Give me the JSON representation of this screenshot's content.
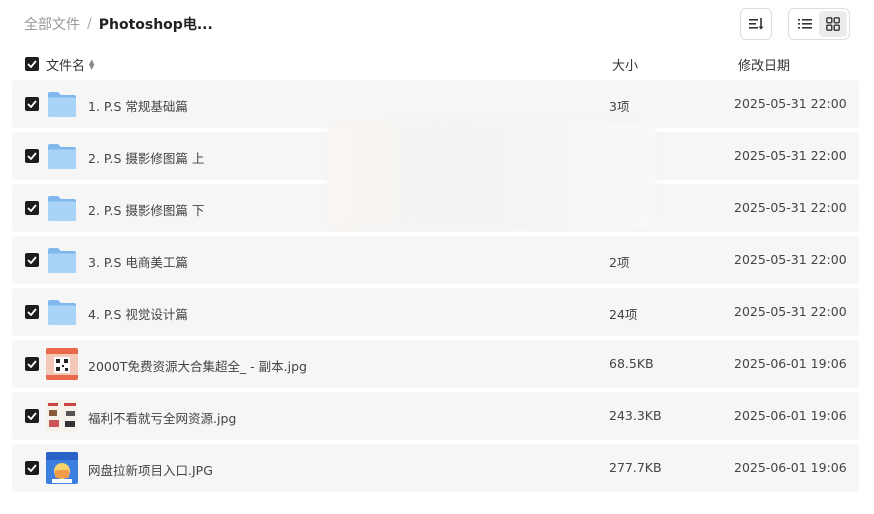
{
  "breadcrumb": {
    "root": "全部文件",
    "separator": "/",
    "current": "Photoshop电..."
  },
  "toolbar": {
    "sort_icon": "sort-icon",
    "list_view_icon": "list-view-icon",
    "grid_view_icon": "grid-view-icon",
    "active_view": "list"
  },
  "columns": {
    "name": "文件名",
    "size": "大小",
    "date": "修改日期"
  },
  "files": [
    {
      "type": "folder",
      "name": "1. P.S 常规基础篇",
      "size": "3项",
      "date": "2025-05-31 22:00",
      "checked": true
    },
    {
      "type": "folder",
      "name": "2. P.S 摄影修图篇 上",
      "size": "",
      "date": "2025-05-31 22:00",
      "checked": true
    },
    {
      "type": "folder",
      "name": "2. P.S 摄影修图篇 下",
      "size": "",
      "date": "2025-05-31 22:00",
      "checked": true
    },
    {
      "type": "folder",
      "name": "3. P.S 电商美工篇",
      "size": "2项",
      "date": "2025-05-31 22:00",
      "checked": true
    },
    {
      "type": "folder",
      "name": "4. P.S 视觉设计篇",
      "size": "24项",
      "date": "2025-05-31 22:00",
      "checked": true
    },
    {
      "type": "image",
      "name": "2000T免费资源大合集超全_ - 副本.jpg",
      "size": "68.5KB",
      "date": "2025-06-01 19:06",
      "checked": true
    },
    {
      "type": "image",
      "name": "福利不看就亏全网资源.jpg",
      "size": "243.3KB",
      "date": "2025-06-01 19:06",
      "checked": true
    },
    {
      "type": "image",
      "name": "网盘拉新项目入口.JPG",
      "size": "277.7KB",
      "date": "2025-06-01 19:06",
      "checked": true
    }
  ],
  "colors": {
    "row_bg": "#f6f6f7",
    "checkbox": "#1d1d1d",
    "folder": "#8ec4f2"
  }
}
